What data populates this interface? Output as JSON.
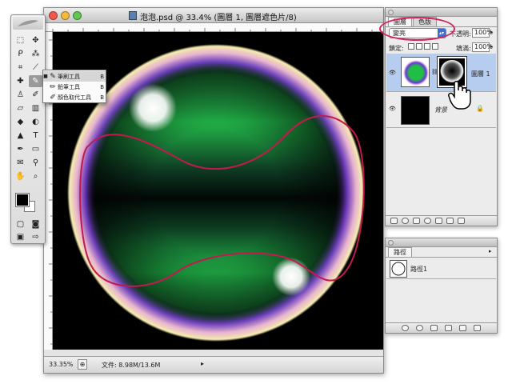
{
  "document": {
    "title": "泡泡.psd @ 33.4% (圖層 1, 圖層遮色片/8)",
    "zoom": "33.35%",
    "file_info": "文件: 8.98M/13.6M"
  },
  "tool_flyout": {
    "items": [
      {
        "label": "筆刷工具",
        "key": "B"
      },
      {
        "label": "鉛筆工具",
        "key": "B"
      },
      {
        "label": "顏色取代工具",
        "key": "B"
      }
    ]
  },
  "layers_panel": {
    "tabs": [
      "圖層",
      "色版"
    ],
    "blend_mode": "變亮",
    "opacity_label": "不透明:",
    "opacity_value": "100%",
    "lock_label": "鎖定:",
    "fill_label": "填滿:",
    "fill_value": "100%",
    "layers": [
      {
        "name": "圖層 1"
      },
      {
        "name": "背景"
      }
    ]
  },
  "paths_panel": {
    "tab": "路徑",
    "paths": [
      {
        "name": "路徑1"
      }
    ]
  },
  "colors": {
    "highlight_ellipse": "#d6245a",
    "path_stroke": "#c21a4e",
    "select_blue": "#3d6fd1",
    "layer_selected": "#b7cdef"
  }
}
